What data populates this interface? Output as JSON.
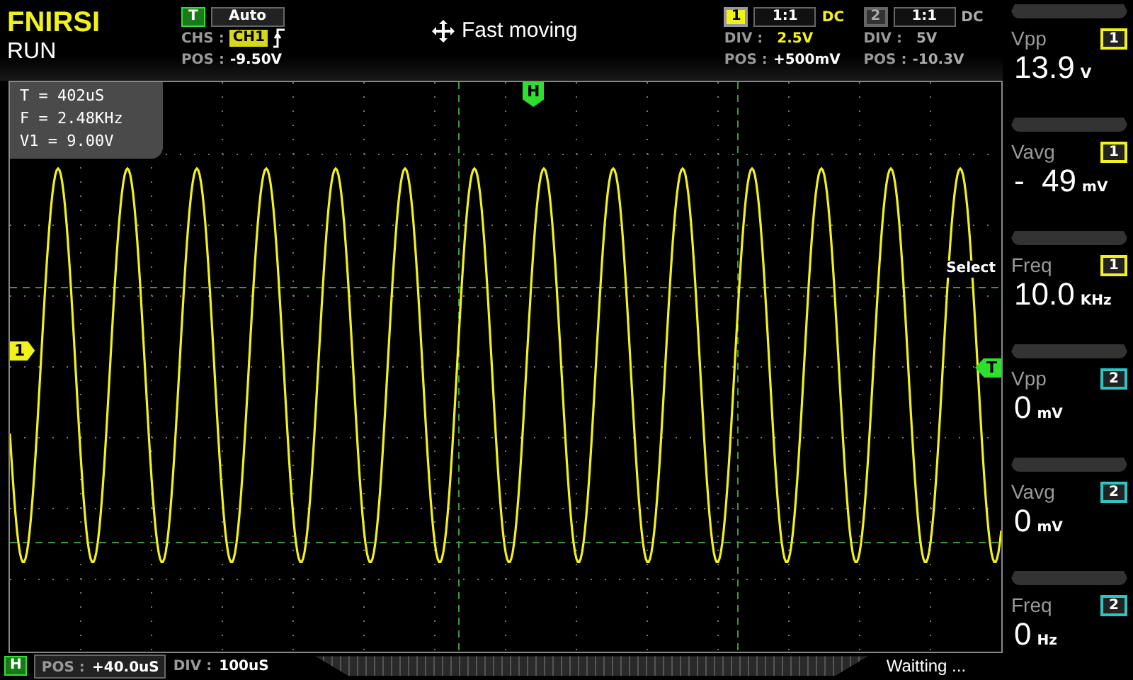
{
  "brand": "FNIRSI",
  "run_state": "RUN",
  "trigger": {
    "badge": "T",
    "mode": "Auto",
    "source_label": "CHS :",
    "source": "CH1",
    "pos_label": "POS :",
    "pos": "-9.50V"
  },
  "status_message": "Fast moving",
  "channels": [
    {
      "badge": "1",
      "probe": "1:1",
      "coupling": "DC",
      "enabled": true,
      "div_label": "DIV :",
      "div": "2.5V",
      "pos_label": "POS :",
      "pos": "+500mV"
    },
    {
      "badge": "2",
      "probe": "1:1",
      "coupling": "DC",
      "enabled": false,
      "div_label": "DIV :",
      "div": "5V",
      "pos_label": "POS :",
      "pos": "-10.3V"
    }
  ],
  "cursor_readout": [
    "T = 402uS",
    "F = 2.48KHz",
    "V1 = 9.00V"
  ],
  "markers": {
    "channel": "1",
    "trigger": "T",
    "horizontal": "H"
  },
  "select_label": "Select",
  "measurements": [
    {
      "name": "Vpp",
      "channel": "1",
      "color": "#f2f21a",
      "value": "13.9",
      "unit": "V"
    },
    {
      "name": "Vavg",
      "channel": "1",
      "color": "#f2f21a",
      "value": "-  49",
      "unit": "mV"
    },
    {
      "name": "Freq",
      "channel": "1",
      "color": "#f2f21a",
      "value": "10.0",
      "unit": "KHz"
    },
    {
      "name": "Vpp",
      "channel": "2",
      "color": "#2ec4c4",
      "value": "0",
      "unit": "mV"
    },
    {
      "name": "Vavg",
      "channel": "2",
      "color": "#2ec4c4",
      "value": "0",
      "unit": "mV"
    },
    {
      "name": "Freq",
      "channel": "2",
      "color": "#2ec4c4",
      "value": "0",
      "unit": "Hz"
    }
  ],
  "timebase": {
    "badge": "H",
    "pos_label": "POS :",
    "pos": "+40.0uS",
    "div_label": "DIV :",
    "div": "100uS"
  },
  "status": "Waitting ..."
}
